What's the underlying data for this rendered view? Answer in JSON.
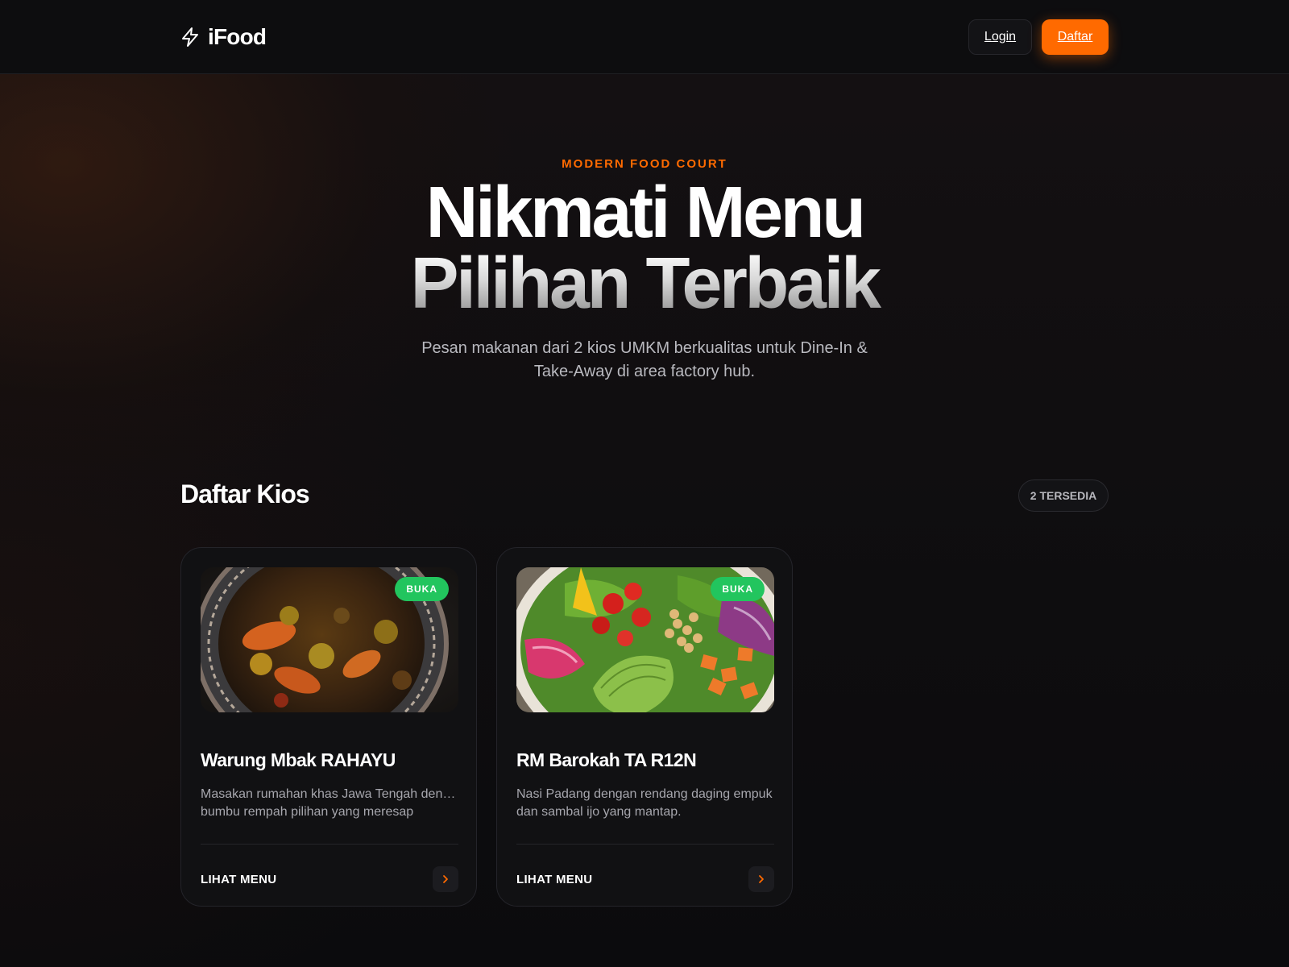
{
  "navbar": {
    "brand_name": "iFood",
    "brand_icon": "lightning-icon",
    "login_label": "Login",
    "register_label": "Daftar"
  },
  "hero": {
    "eyebrow": "MODERN FOOD COURT",
    "headline_line1": "Nikmati Menu",
    "headline_line2": "Pilihan Terbaik",
    "subtitle": "Pesan makanan dari 2 kios UMKM berkualitas untuk Dine-In & Take-Away di area factory hub."
  },
  "kiosk_section": {
    "title": "Daftar Kios",
    "count_badge": "2 TERSEDIA",
    "kiosks": [
      {
        "name": "Warung Mbak RAHAYU",
        "status": "BUKA",
        "description_line1": "Masakan rumahan khas Jawa Tengah dengan",
        "description_line2": "bumbu rempah pilihan yang meresap",
        "cta": "LIHAT MENU",
        "image": "stew-bowl-photo"
      },
      {
        "name": "RM Barokah TA R12N",
        "status": "BUKA",
        "description_line1": "Nasi Padang dengan rendang daging empuk",
        "description_line2": "dan sambal ijo yang mantap.",
        "cta": "LIHAT MENU",
        "image": "salad-bowl-photo"
      }
    ]
  },
  "colors": {
    "accent": "#ff6a00",
    "status_open": "#22c55e",
    "background": "#0b0b0d"
  }
}
